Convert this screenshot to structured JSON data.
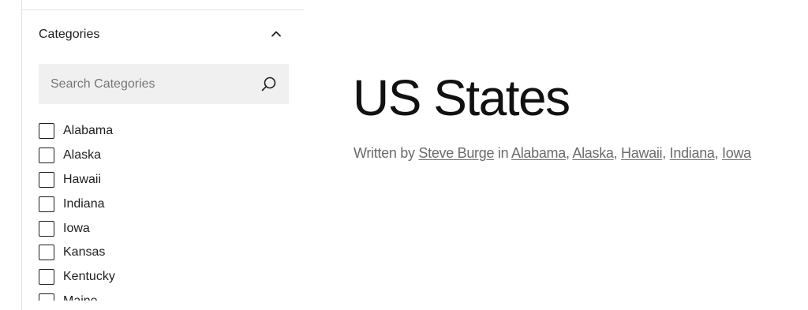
{
  "sidebar": {
    "panel_title": "Categories",
    "search_placeholder": "Search Categories",
    "categories": [
      {
        "label": "Alabama",
        "checked": false
      },
      {
        "label": "Alaska",
        "checked": false
      },
      {
        "label": "Hawaii",
        "checked": false
      },
      {
        "label": "Indiana",
        "checked": false
      },
      {
        "label": "Iowa",
        "checked": false
      },
      {
        "label": "Kansas",
        "checked": false
      },
      {
        "label": "Kentucky",
        "checked": false
      },
      {
        "label": "Maine",
        "checked": false
      }
    ],
    "icons": {
      "collapse": "chevron-up-icon",
      "search": "search-icon"
    }
  },
  "post": {
    "title": "US States",
    "written_by": "Written by",
    "author": "Steve Burge",
    "in_text": "in",
    "categories": [
      "Alabama",
      "Alaska",
      "Hawaii",
      "Indiana",
      "Iowa"
    ],
    "separator": ","
  }
}
